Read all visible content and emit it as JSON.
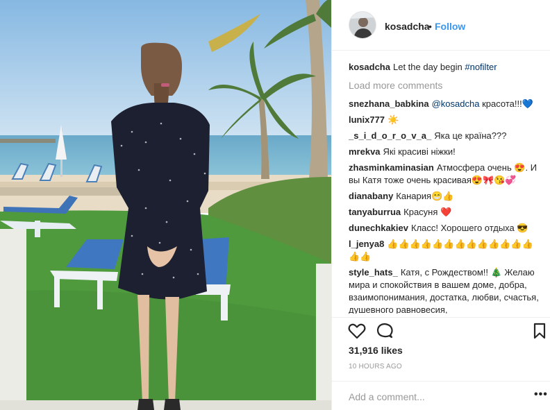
{
  "post": {
    "username": "kosadcha",
    "separator": "•",
    "follow_label": "Follow",
    "caption": {
      "user": "kosadcha",
      "text": "Let the day begin",
      "hashtag": "#nofilter"
    },
    "load_more_label": "Load more comments",
    "comments": [
      {
        "user": "snezhana_babkina",
        "mention": "@kosadcha",
        "text": "красота!!!💙"
      },
      {
        "user": "lunix777",
        "text": "☀️"
      },
      {
        "user": "_s_i_d_o_r_o_v_a_",
        "text": "Яка це країна???"
      },
      {
        "user": "mrekva",
        "text": "Які красиві ніжки!"
      },
      {
        "user": "zhasminkaminasian",
        "text": "Атмосфера очень 😍. И вы Катя тоже очень красивая😍🎀😘💞"
      },
      {
        "user": "dianabany",
        "text": "Канария😁👍"
      },
      {
        "user": "tanyaburrua",
        "text": "Красуня ❤️"
      },
      {
        "user": "dunechkakiev",
        "text": "Класс! Хорошего отдыха 😎"
      },
      {
        "user": "l_jenya8",
        "text": "👍👍👍👍👍👍👍👍👍👍👍👍👍👍👍"
      },
      {
        "user": "style_hats_",
        "text": "Катя, с Рождеством!! 🎄 Желаю мира и спокойствия в вашем доме, добра, взаимопонимания, достатка, любви, счастья, душевного равновесия,"
      }
    ],
    "likes": "31,916 likes",
    "time": "10 HOURS AGO",
    "add_comment_placeholder": "Add a comment...",
    "more_label": "•••",
    "icons": {
      "like": "heart-icon",
      "comment": "comment-icon",
      "save": "bookmark-icon"
    },
    "colors": {
      "link": "#3897f0",
      "text": "#262626",
      "muted": "#999999",
      "hashtag": "#003569"
    }
  }
}
